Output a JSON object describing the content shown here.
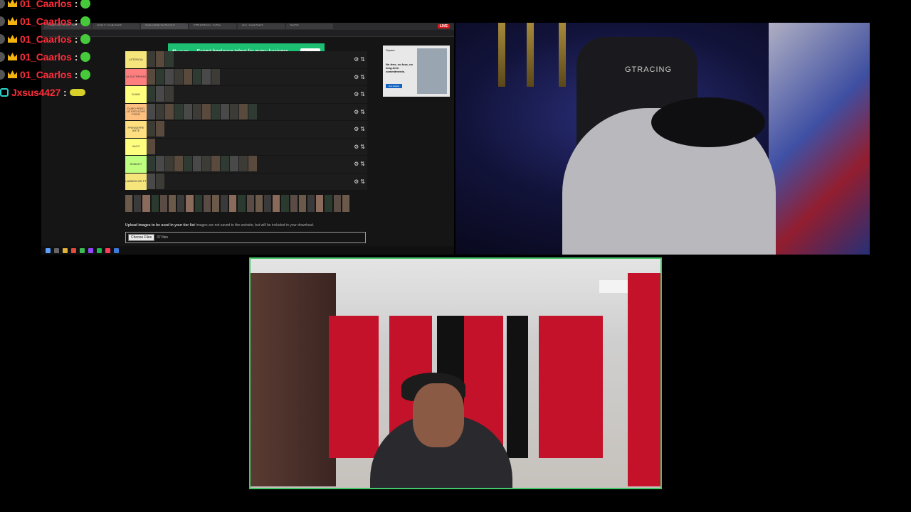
{
  "chat": {
    "messages": [
      {
        "user": "01_Caarlos",
        "badge": "crown",
        "emote": "green"
      },
      {
        "user": "01_Caarlos",
        "badge": "crown",
        "emote": "green"
      },
      {
        "user": "01_Caarlos",
        "badge": "crown",
        "emote": "green"
      },
      {
        "user": "01_Caarlos",
        "badge": "crown",
        "emote": "green"
      },
      {
        "user": "01_Caarlos",
        "badge": "crown",
        "emote": "green"
      },
      {
        "user": "Jxsus4427",
        "badge": "key",
        "emote": "yellow"
      }
    ],
    "colon": ":"
  },
  "browser": {
    "tabs": [
      "Create a New Tier List - TierM",
      "tourlab nf - Google Search",
      "Create a Single-Use Tier List O",
      "GTRS Ed Buttons - YouTube",
      "tener - Google Search",
      "New Tab"
    ],
    "live_label": "LIVE",
    "ad": {
      "brand": "fiverr.",
      "text": "Expert freelance talent for every business",
      "cta": "Get started"
    },
    "side_ad": {
      "brand": "Square",
      "text": "No fees, no fuss, no long-term commitments.",
      "cta": "Get started"
    },
    "tiers": [
      {
        "label": "LETERCIA",
        "color": "#f5e57a",
        "items": 3
      },
      {
        "label": "LA DUTRRIVAS",
        "color": "#ff7f7f",
        "items": 8
      },
      {
        "label": "DUNO",
        "color": "#ffff7f",
        "items": 3
      },
      {
        "label": "DURO PERO LO ESCUCHO POCO",
        "color": "#ffbf7f",
        "items": 12
      },
      {
        "label": "PRINSEPPE ARTE",
        "color": "#ffdf7f",
        "items": 2
      },
      {
        "label": "VACO",
        "color": "#ffff7f",
        "items": 1
      },
      {
        "label": "NOBUEY",
        "color": "#bfff7f",
        "items": 12
      },
      {
        "label": "LAMBON DE FT",
        "color": "#f5e57a",
        "items": 2
      }
    ],
    "pool_count": 26,
    "upload": {
      "heading": "Upload images to be used in your tier list",
      "note": "Images are not saved to the website, but will be included in your download.",
      "button": "Choose Files",
      "file_count": "37 files"
    }
  },
  "stream": {
    "chair_logo": "GTRACING"
  }
}
